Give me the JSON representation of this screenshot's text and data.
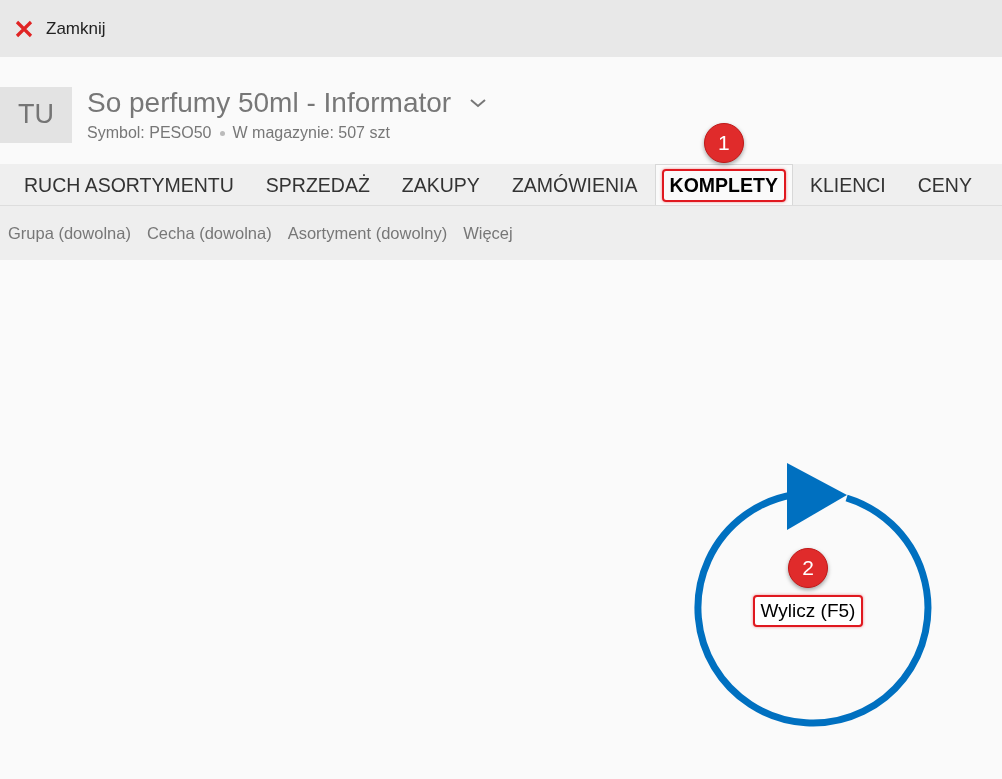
{
  "toolbar": {
    "close_label": "Zamknij"
  },
  "header": {
    "avatar": "TU",
    "title": "So perfumy 50ml - Informator",
    "symbol": "Symbol: PESO50",
    "stock": "W magazynie: 507 szt"
  },
  "tabs": [
    {
      "label": "RUCH ASORTYMENTU",
      "selected": false,
      "highlighted": false
    },
    {
      "label": "SPRZEDAŻ",
      "selected": false,
      "highlighted": false
    },
    {
      "label": "ZAKUPY",
      "selected": false,
      "highlighted": false
    },
    {
      "label": "ZAMÓWIENIA",
      "selected": false,
      "highlighted": false
    },
    {
      "label": "KOMPLETY",
      "selected": true,
      "highlighted": true,
      "badge": "1"
    },
    {
      "label": "KLIENCI",
      "selected": false,
      "highlighted": false
    },
    {
      "label": "CENY",
      "selected": false,
      "highlighted": false
    }
  ],
  "filters": [
    "Grupa (dowolna)",
    "Cecha (dowolna)",
    "Asortyment (dowolny)",
    "Więcej"
  ],
  "refresh": {
    "label": "Wylicz (F5)",
    "highlighted": true,
    "badge": "2"
  }
}
